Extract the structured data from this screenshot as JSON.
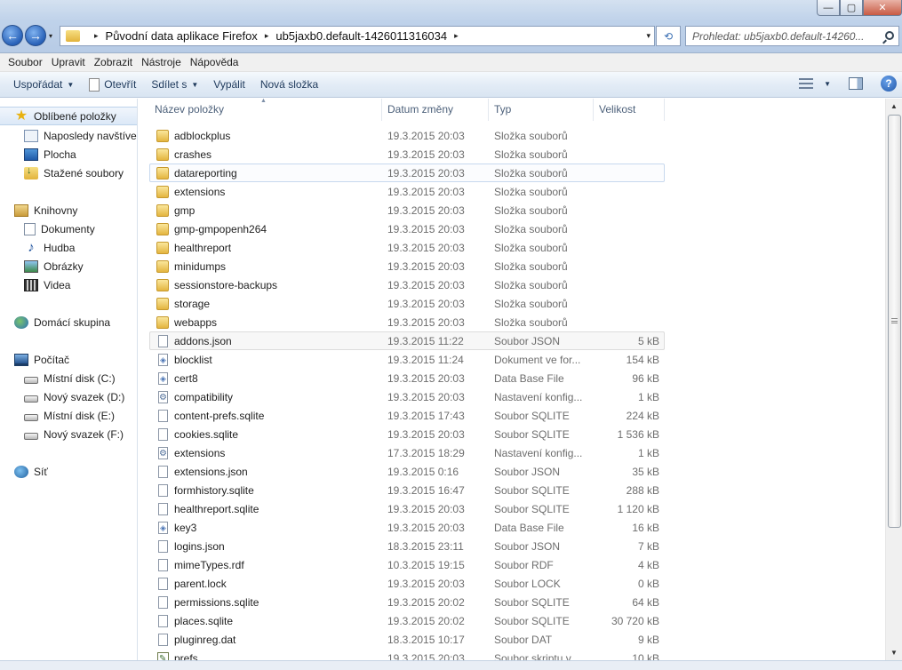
{
  "window": {
    "minimize_glyph": "—",
    "maximize_glyph": "▢",
    "close_glyph": "✕"
  },
  "navigation": {
    "back_glyph": "←",
    "forward_glyph": "→",
    "history_glyph": "▾",
    "breadcrumb": [
      "Původní data aplikace Firefox",
      "ub5jaxb0.default-1426011316034"
    ],
    "breadcrumb_separator": "▸",
    "address_dropdown_glyph": "▾",
    "refresh_glyph": "⟲",
    "search_placeholder": "Prohledat: ub5jaxb0.default-14260..."
  },
  "menubar": [
    "Soubor",
    "Upravit",
    "Zobrazit",
    "Nástroje",
    "Nápověda"
  ],
  "toolbar": {
    "organize": "Uspořádat",
    "open": "Otevřít",
    "share": "Sdílet s",
    "burn": "Vypálit",
    "new_folder": "Nová složka",
    "dropdown_glyph": "▼",
    "help_glyph": "?"
  },
  "navpane": {
    "favorites": {
      "label": "Oblíbené položky",
      "icon": "star-icon",
      "items": [
        {
          "label": "Naposledy navštívené",
          "icon": "recent-places-icon"
        },
        {
          "label": "Plocha",
          "icon": "desktop-icon"
        },
        {
          "label": "Stažené soubory",
          "icon": "downloads-icon"
        }
      ]
    },
    "libraries": {
      "label": "Knihovny",
      "icon": "libraries-icon",
      "items": [
        {
          "label": "Dokumenty",
          "icon": "documents-icon"
        },
        {
          "label": "Hudba",
          "icon": "music-icon"
        },
        {
          "label": "Obrázky",
          "icon": "pictures-icon"
        },
        {
          "label": "Videa",
          "icon": "videos-icon"
        }
      ]
    },
    "homegroup": {
      "label": "Domácí skupina",
      "icon": "homegroup-icon"
    },
    "computer": {
      "label": "Počítač",
      "icon": "computer-icon",
      "items": [
        {
          "label": "Místní disk (C:)",
          "icon": "drive-icon"
        },
        {
          "label": "Nový svazek (D:)",
          "icon": "drive-icon"
        },
        {
          "label": "Místní disk (E:)",
          "icon": "drive-icon"
        },
        {
          "label": "Nový svazek (F:)",
          "icon": "drive-icon"
        }
      ]
    },
    "network": {
      "label": "Síť",
      "icon": "network-icon"
    },
    "music_glyph": "♪",
    "star_glyph": "★"
  },
  "columns": {
    "name": "Název položky",
    "date": "Datum změny",
    "type": "Typ",
    "size": "Velikost",
    "sort_glyph": "▲"
  },
  "files": [
    {
      "name": "adblockplus",
      "date": "19.3.2015 20:03",
      "type": "Složka souborů",
      "size": "",
      "icon": "folder"
    },
    {
      "name": "crashes",
      "date": "19.3.2015 20:03",
      "type": "Složka souborů",
      "size": "",
      "icon": "folder"
    },
    {
      "name": "datareporting",
      "date": "19.3.2015 20:03",
      "type": "Složka souborů",
      "size": "",
      "icon": "folder"
    },
    {
      "name": "extensions",
      "date": "19.3.2015 20:03",
      "type": "Složka souborů",
      "size": "",
      "icon": "folder"
    },
    {
      "name": "gmp",
      "date": "19.3.2015 20:03",
      "type": "Složka souborů",
      "size": "",
      "icon": "folder"
    },
    {
      "name": "gmp-gmpopenh264",
      "date": "19.3.2015 20:03",
      "type": "Složka souborů",
      "size": "",
      "icon": "folder"
    },
    {
      "name": "healthreport",
      "date": "19.3.2015 20:03",
      "type": "Složka souborů",
      "size": "",
      "icon": "folder"
    },
    {
      "name": "minidumps",
      "date": "19.3.2015 20:03",
      "type": "Složka souborů",
      "size": "",
      "icon": "folder"
    },
    {
      "name": "sessionstore-backups",
      "date": "19.3.2015 20:03",
      "type": "Složka souborů",
      "size": "",
      "icon": "folder"
    },
    {
      "name": "storage",
      "date": "19.3.2015 20:03",
      "type": "Složka souborů",
      "size": "",
      "icon": "folder"
    },
    {
      "name": "webapps",
      "date": "19.3.2015 20:03",
      "type": "Složka souborů",
      "size": "",
      "icon": "folder"
    },
    {
      "name": "addons.json",
      "date": "19.3.2015 11:22",
      "type": "Soubor JSON",
      "size": "5 kB",
      "icon": "file"
    },
    {
      "name": "blocklist",
      "date": "19.3.2015 11:24",
      "type": "Dokument ve for...",
      "size": "154 kB",
      "icon": "dll"
    },
    {
      "name": "cert8",
      "date": "19.3.2015 20:03",
      "type": "Data Base File",
      "size": "96 kB",
      "icon": "dll"
    },
    {
      "name": "compatibility",
      "date": "19.3.2015 20:03",
      "type": "Nastavení konfig...",
      "size": "1 kB",
      "icon": "gear"
    },
    {
      "name": "content-prefs.sqlite",
      "date": "19.3.2015 17:43",
      "type": "Soubor SQLITE",
      "size": "224 kB",
      "icon": "file"
    },
    {
      "name": "cookies.sqlite",
      "date": "19.3.2015 20:03",
      "type": "Soubor SQLITE",
      "size": "1 536 kB",
      "icon": "file"
    },
    {
      "name": "extensions",
      "date": "17.3.2015 18:29",
      "type": "Nastavení konfig...",
      "size": "1 kB",
      "icon": "gear"
    },
    {
      "name": "extensions.json",
      "date": "19.3.2015 0:16",
      "type": "Soubor JSON",
      "size": "35 kB",
      "icon": "file"
    },
    {
      "name": "formhistory.sqlite",
      "date": "19.3.2015 16:47",
      "type": "Soubor SQLITE",
      "size": "288 kB",
      "icon": "file"
    },
    {
      "name": "healthreport.sqlite",
      "date": "19.3.2015 20:03",
      "type": "Soubor SQLITE",
      "size": "1 120 kB",
      "icon": "file"
    },
    {
      "name": "key3",
      "date": "19.3.2015 20:03",
      "type": "Data Base File",
      "size": "16 kB",
      "icon": "dll"
    },
    {
      "name": "logins.json",
      "date": "18.3.2015 23:11",
      "type": "Soubor JSON",
      "size": "7 kB",
      "icon": "file"
    },
    {
      "name": "mimeTypes.rdf",
      "date": "10.3.2015 19:15",
      "type": "Soubor RDF",
      "size": "4 kB",
      "icon": "file"
    },
    {
      "name": "parent.lock",
      "date": "19.3.2015 20:03",
      "type": "Soubor LOCK",
      "size": "0 kB",
      "icon": "file"
    },
    {
      "name": "permissions.sqlite",
      "date": "19.3.2015 20:02",
      "type": "Soubor SQLITE",
      "size": "64 kB",
      "icon": "file"
    },
    {
      "name": "places.sqlite",
      "date": "19.3.2015 20:02",
      "type": "Soubor SQLITE",
      "size": "30 720 kB",
      "icon": "file"
    },
    {
      "name": "pluginreg.dat",
      "date": "18.3.2015 10:17",
      "type": "Soubor DAT",
      "size": "9 kB",
      "icon": "file"
    },
    {
      "name": "prefs",
      "date": "19.3.2015 20:03",
      "type": "Soubor skriptu v ...",
      "size": "10 kB",
      "icon": "script"
    }
  ],
  "scrollbar": {
    "up_glyph": "▲",
    "down_glyph": "▼"
  }
}
